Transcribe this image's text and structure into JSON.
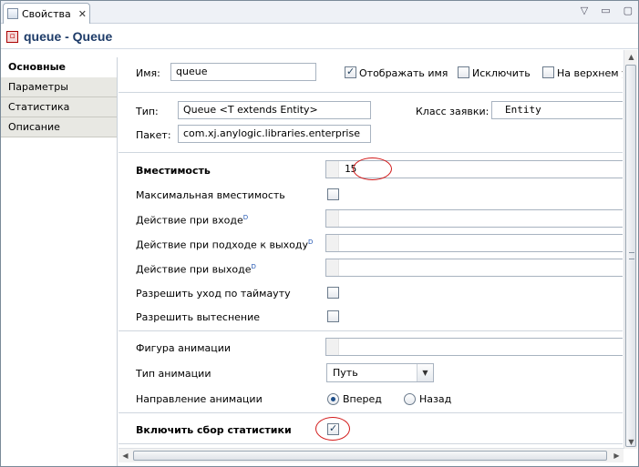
{
  "tab": {
    "label": "Свойства",
    "close": "✕",
    "icon": "properties-icon"
  },
  "window_controls": {
    "view_menu": "▽",
    "minimize": "▭",
    "maximize": "▢"
  },
  "title": {
    "text": "queue - Queue",
    "icon": "queue-block-icon"
  },
  "nav": {
    "items": [
      {
        "label": "Основные",
        "active": true
      },
      {
        "label": "Параметры",
        "active": false
      },
      {
        "label": "Статистика",
        "active": false
      },
      {
        "label": "Описание",
        "active": false
      }
    ]
  },
  "general": {
    "name_label": "Имя:",
    "name_value": "queue",
    "show_name_label": "Отображать имя",
    "show_name_checked": true,
    "exclude_label": "Исключить",
    "exclude_checked": false,
    "on_top_label": "На верхнем у",
    "on_top_checked": false
  },
  "type_info": {
    "type_label": "Тип:",
    "type_value": "Queue <T extends Entity>",
    "agent_class_label": "Класс заявки:",
    "agent_class_value": "Entity",
    "package_label": "Пакет:",
    "package_value": "com.xj.anylogic.libraries.enterprise"
  },
  "params": {
    "capacity_label": "Вместимость",
    "capacity_value": "15",
    "max_capacity_label": "Максимальная вместимость",
    "max_capacity_checked": false,
    "on_enter_label": "Действие при входе",
    "on_enter_sup": "D",
    "on_at_exit_label": "Действие при подходе к выходу",
    "on_at_exit_sup": "D",
    "on_exit_label": "Действие при выходе",
    "on_exit_sup": "D",
    "timeout_label": "Разрешить уход по таймауту",
    "timeout_checked": false,
    "preemption_label": "Разрешить вытеснение",
    "preemption_checked": false
  },
  "animation": {
    "shape_label": "Фигура анимации",
    "type_label": "Тип анимации",
    "type_value": "Путь",
    "direction_label": "Направление анимации",
    "forward_label": "Вперед",
    "forward_selected": true,
    "backward_label": "Назад",
    "backward_selected": false
  },
  "statistics": {
    "enable_label": "Включить сбор статистики",
    "enable_checked": true
  },
  "colors": {
    "highlight": "#d21a1a",
    "title_text": "#1d3b68"
  }
}
